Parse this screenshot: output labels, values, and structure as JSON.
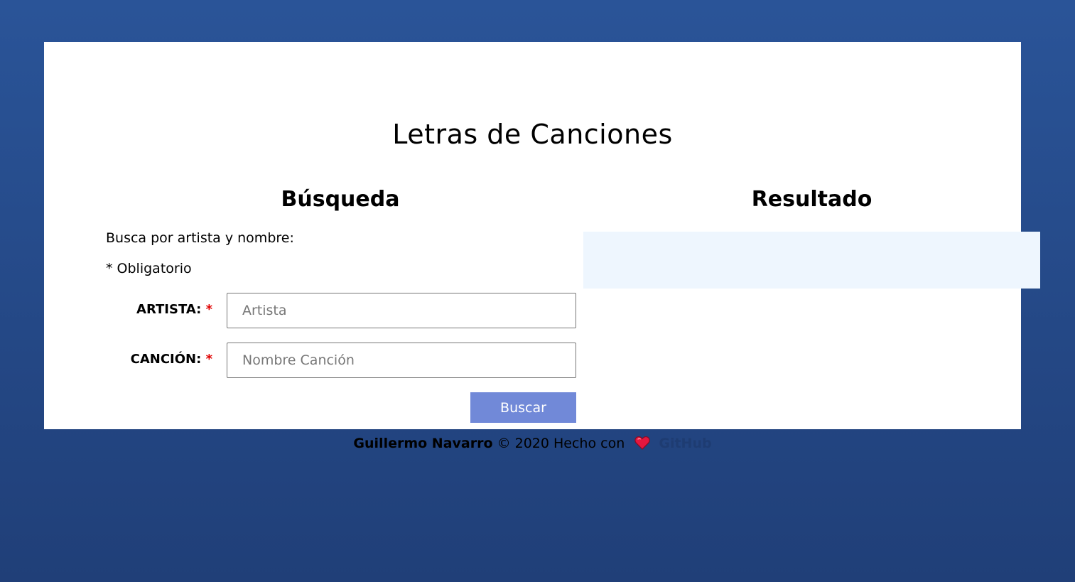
{
  "app": {
    "title": "Letras de Canciones"
  },
  "search": {
    "heading": "Búsqueda",
    "intro": "Busca por artista y nombre:",
    "required_note": "* Obligatorio",
    "artist_label": "ARTISTA:",
    "artist_placeholder": "Artista",
    "song_label": "CANCIÓN:",
    "song_placeholder": "Nombre Canción",
    "required_marker": "*",
    "submit_label": "Buscar"
  },
  "result": {
    "heading": "Resultado",
    "content": ""
  },
  "footer": {
    "author": "Guillermo Navarro",
    "copyright": "© 2020 Hecho con",
    "heart_icon": "heart-icon",
    "link_label": "GitHub"
  },
  "colors": {
    "background_top": "#2a5498",
    "background_bottom": "#203f78",
    "button": "#7189d8",
    "result_box": "#eef6fe",
    "required": "#e00000",
    "link": "#1e3c72"
  }
}
